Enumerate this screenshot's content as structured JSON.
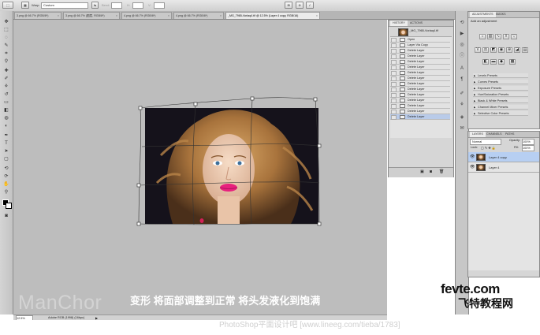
{
  "options_bar": {
    "tool_glyph": "⬚",
    "mode_label": "Warp:",
    "mode_value": "Custom",
    "field_labels": [
      "Bend:",
      "H:",
      "V:"
    ],
    "field_values": [
      "",
      "",
      ""
    ]
  },
  "tabs": [
    {
      "label": "3.png @ 66.7% (RGB/8*)"
    },
    {
      "label": "3.png @ 66.7% (图层, RGB/8*)"
    },
    {
      "label": "4.png @ 66.7% (RGB/8*)"
    },
    {
      "label": "4.png @ 66.7% (RGB/8*)"
    },
    {
      "label": "_MG_7965-Vorlaq4.tif @ 12.5% (Layer 4 copy, RGB/16)"
    }
  ],
  "history": {
    "tabs": [
      "HISTORY",
      "ACTIONS"
    ],
    "snapshot": "_MG_7965-Vorlaq4.tif",
    "items": [
      "Open",
      "Layer Via Copy",
      "Delete Layer",
      "Delete Layer",
      "Delete Layer",
      "Delete Layer",
      "Delete Layer",
      "Delete Layer",
      "Delete Layer",
      "Delete Layer",
      "Delete Layer",
      "Delete Layer",
      "Delete Layer",
      "Delete Layer",
      "Delete Layer"
    ]
  },
  "adjustments": {
    "tabs": [
      "ADJUSTMENTS",
      "MASKS"
    ],
    "header": "Add an adjustment",
    "presets": [
      "Levels Presets",
      "Curves Presets",
      "Exposure Presets",
      "Hue/Saturation Presets",
      "Black & White Presets",
      "Channel Mixer Presets",
      "Selective Color Presets"
    ]
  },
  "layers": {
    "tabs": [
      "LAYERS",
      "CHANNELS",
      "PATHS"
    ],
    "blend_mode": "Normal",
    "opacity_label": "Opacity:",
    "opacity_value": "100%",
    "lock_label": "Lock:",
    "fill_label": "Fill:",
    "fill_value": "100%",
    "items": [
      {
        "name": "Layer 4 copy",
        "selected": true
      },
      {
        "name": "Layer 4",
        "selected": false
      }
    ]
  },
  "status": {
    "zoom": "12.5%",
    "doc_info": "Adobe RGB (1998) (16bpc)"
  },
  "caption": "变形 将面部调整到正常 将头发液化到饱满",
  "watermark_left": "ManChor",
  "logo": {
    "top": "fevte.com",
    "bottom": "飞特教程网"
  },
  "footer_text": "PhotoShop平面设计吧 [www.lineeg.com/tieba/1783]"
}
